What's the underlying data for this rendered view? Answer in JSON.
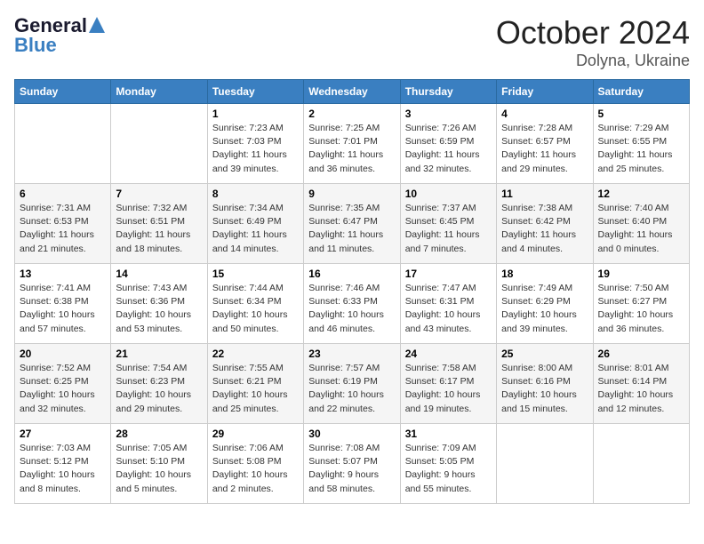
{
  "logo": {
    "line1": "General",
    "line2": "Blue"
  },
  "title": "October 2024",
  "subtitle": "Dolyna, Ukraine",
  "days_of_week": [
    "Sunday",
    "Monday",
    "Tuesday",
    "Wednesday",
    "Thursday",
    "Friday",
    "Saturday"
  ],
  "weeks": [
    [
      {
        "day": "",
        "info": ""
      },
      {
        "day": "",
        "info": ""
      },
      {
        "day": "1",
        "sunrise": "Sunrise: 7:23 AM",
        "sunset": "Sunset: 7:03 PM",
        "daylight": "Daylight: 11 hours and 39 minutes."
      },
      {
        "day": "2",
        "sunrise": "Sunrise: 7:25 AM",
        "sunset": "Sunset: 7:01 PM",
        "daylight": "Daylight: 11 hours and 36 minutes."
      },
      {
        "day": "3",
        "sunrise": "Sunrise: 7:26 AM",
        "sunset": "Sunset: 6:59 PM",
        "daylight": "Daylight: 11 hours and 32 minutes."
      },
      {
        "day": "4",
        "sunrise": "Sunrise: 7:28 AM",
        "sunset": "Sunset: 6:57 PM",
        "daylight": "Daylight: 11 hours and 29 minutes."
      },
      {
        "day": "5",
        "sunrise": "Sunrise: 7:29 AM",
        "sunset": "Sunset: 6:55 PM",
        "daylight": "Daylight: 11 hours and 25 minutes."
      }
    ],
    [
      {
        "day": "6",
        "sunrise": "Sunrise: 7:31 AM",
        "sunset": "Sunset: 6:53 PM",
        "daylight": "Daylight: 11 hours and 21 minutes."
      },
      {
        "day": "7",
        "sunrise": "Sunrise: 7:32 AM",
        "sunset": "Sunset: 6:51 PM",
        "daylight": "Daylight: 11 hours and 18 minutes."
      },
      {
        "day": "8",
        "sunrise": "Sunrise: 7:34 AM",
        "sunset": "Sunset: 6:49 PM",
        "daylight": "Daylight: 11 hours and 14 minutes."
      },
      {
        "day": "9",
        "sunrise": "Sunrise: 7:35 AM",
        "sunset": "Sunset: 6:47 PM",
        "daylight": "Daylight: 11 hours and 11 minutes."
      },
      {
        "day": "10",
        "sunrise": "Sunrise: 7:37 AM",
        "sunset": "Sunset: 6:45 PM",
        "daylight": "Daylight: 11 hours and 7 minutes."
      },
      {
        "day": "11",
        "sunrise": "Sunrise: 7:38 AM",
        "sunset": "Sunset: 6:42 PM",
        "daylight": "Daylight: 11 hours and 4 minutes."
      },
      {
        "day": "12",
        "sunrise": "Sunrise: 7:40 AM",
        "sunset": "Sunset: 6:40 PM",
        "daylight": "Daylight: 11 hours and 0 minutes."
      }
    ],
    [
      {
        "day": "13",
        "sunrise": "Sunrise: 7:41 AM",
        "sunset": "Sunset: 6:38 PM",
        "daylight": "Daylight: 10 hours and 57 minutes."
      },
      {
        "day": "14",
        "sunrise": "Sunrise: 7:43 AM",
        "sunset": "Sunset: 6:36 PM",
        "daylight": "Daylight: 10 hours and 53 minutes."
      },
      {
        "day": "15",
        "sunrise": "Sunrise: 7:44 AM",
        "sunset": "Sunset: 6:34 PM",
        "daylight": "Daylight: 10 hours and 50 minutes."
      },
      {
        "day": "16",
        "sunrise": "Sunrise: 7:46 AM",
        "sunset": "Sunset: 6:33 PM",
        "daylight": "Daylight: 10 hours and 46 minutes."
      },
      {
        "day": "17",
        "sunrise": "Sunrise: 7:47 AM",
        "sunset": "Sunset: 6:31 PM",
        "daylight": "Daylight: 10 hours and 43 minutes."
      },
      {
        "day": "18",
        "sunrise": "Sunrise: 7:49 AM",
        "sunset": "Sunset: 6:29 PM",
        "daylight": "Daylight: 10 hours and 39 minutes."
      },
      {
        "day": "19",
        "sunrise": "Sunrise: 7:50 AM",
        "sunset": "Sunset: 6:27 PM",
        "daylight": "Daylight: 10 hours and 36 minutes."
      }
    ],
    [
      {
        "day": "20",
        "sunrise": "Sunrise: 7:52 AM",
        "sunset": "Sunset: 6:25 PM",
        "daylight": "Daylight: 10 hours and 32 minutes."
      },
      {
        "day": "21",
        "sunrise": "Sunrise: 7:54 AM",
        "sunset": "Sunset: 6:23 PM",
        "daylight": "Daylight: 10 hours and 29 minutes."
      },
      {
        "day": "22",
        "sunrise": "Sunrise: 7:55 AM",
        "sunset": "Sunset: 6:21 PM",
        "daylight": "Daylight: 10 hours and 25 minutes."
      },
      {
        "day": "23",
        "sunrise": "Sunrise: 7:57 AM",
        "sunset": "Sunset: 6:19 PM",
        "daylight": "Daylight: 10 hours and 22 minutes."
      },
      {
        "day": "24",
        "sunrise": "Sunrise: 7:58 AM",
        "sunset": "Sunset: 6:17 PM",
        "daylight": "Daylight: 10 hours and 19 minutes."
      },
      {
        "day": "25",
        "sunrise": "Sunrise: 8:00 AM",
        "sunset": "Sunset: 6:16 PM",
        "daylight": "Daylight: 10 hours and 15 minutes."
      },
      {
        "day": "26",
        "sunrise": "Sunrise: 8:01 AM",
        "sunset": "Sunset: 6:14 PM",
        "daylight": "Daylight: 10 hours and 12 minutes."
      }
    ],
    [
      {
        "day": "27",
        "sunrise": "Sunrise: 7:03 AM",
        "sunset": "Sunset: 5:12 PM",
        "daylight": "Daylight: 10 hours and 8 minutes."
      },
      {
        "day": "28",
        "sunrise": "Sunrise: 7:05 AM",
        "sunset": "Sunset: 5:10 PM",
        "daylight": "Daylight: 10 hours and 5 minutes."
      },
      {
        "day": "29",
        "sunrise": "Sunrise: 7:06 AM",
        "sunset": "Sunset: 5:08 PM",
        "daylight": "Daylight: 10 hours and 2 minutes."
      },
      {
        "day": "30",
        "sunrise": "Sunrise: 7:08 AM",
        "sunset": "Sunset: 5:07 PM",
        "daylight": "Daylight: 9 hours and 58 minutes."
      },
      {
        "day": "31",
        "sunrise": "Sunrise: 7:09 AM",
        "sunset": "Sunset: 5:05 PM",
        "daylight": "Daylight: 9 hours and 55 minutes."
      },
      {
        "day": "",
        "info": ""
      },
      {
        "day": "",
        "info": ""
      }
    ]
  ]
}
